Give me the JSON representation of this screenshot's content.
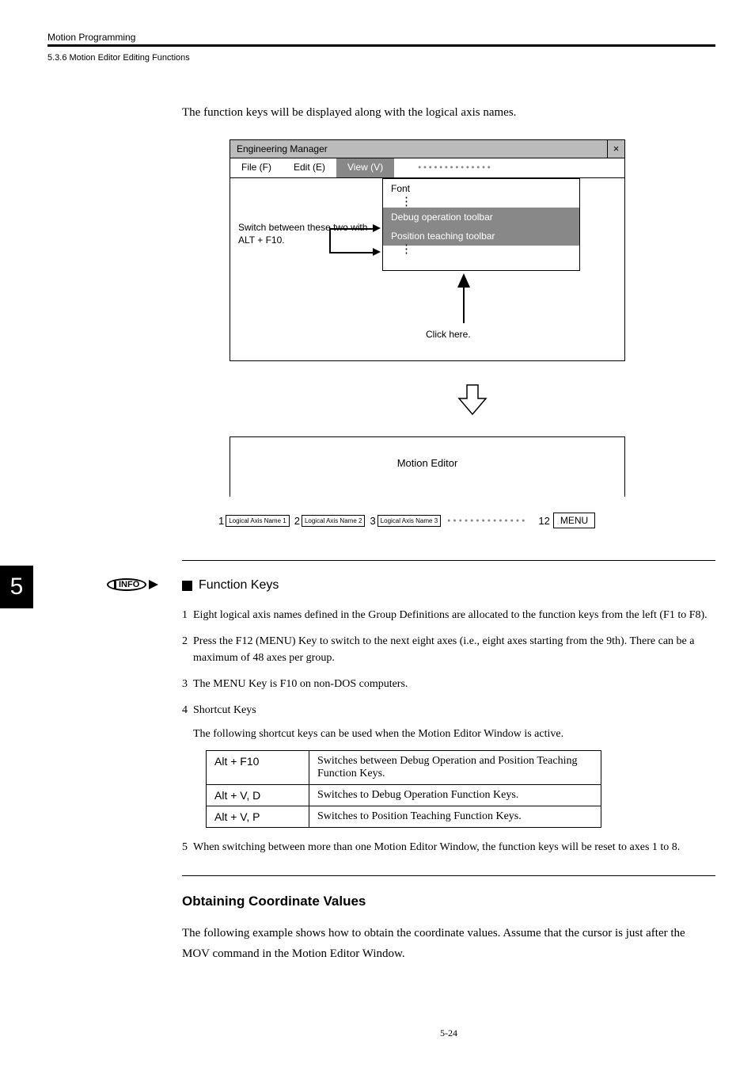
{
  "header": {
    "title": "Motion Programming",
    "subtitle": "5.3.6  Motion Editor Editing Functions"
  },
  "intro": "The function keys will be displayed along with the logical axis names.",
  "figure1": {
    "windowTitle": "Engineering Manager",
    "closeGlyph": "×",
    "menus": {
      "file": "File (F)",
      "edit": "Edit (E)",
      "view": "View (V)"
    },
    "switchText": "Switch between these two with ALT + F10.",
    "dropdown": {
      "font": "Font",
      "debug": "Debug operation toolbar",
      "position": "Position teaching toolbar"
    },
    "clickHere": "Click here."
  },
  "figure2": {
    "title": "Motion Editor",
    "fkeys": {
      "n1": "1",
      "b1": "Logical Axis Name 1",
      "n2": "2",
      "b2": "Logical Axis Name 2",
      "n3": "3",
      "b3": "Logical Axis Name 3",
      "n12": "12",
      "menu": "MENU"
    }
  },
  "pageTab": "5",
  "infoLabel": "INFO",
  "fnKeysTitle": "Function Keys",
  "list": {
    "i1n": "1",
    "i1": "Eight logical axis names defined in the Group Definitions are allocated to the function keys from the left (F1 to F8).",
    "i2n": "2",
    "i2": "Press the F12 (MENU) Key to switch to the next eight axes (i.e., eight axes starting from the 9th). There can be a maximum of 48 axes per group.",
    "i3n": "3",
    "i3": "The MENU Key is F10 on non-DOS computers.",
    "i4n": "4",
    "i4": "Shortcut Keys",
    "i4sub": "The following shortcut keys can be used when the Motion Editor Window is active.",
    "i5n": "5",
    "i5": "When switching between more than one Motion Editor Window, the function keys will be reset to axes 1 to 8."
  },
  "table": {
    "r1k": "Alt + F10",
    "r1v": "Switches between Debug Operation and Position Teaching Function Keys.",
    "r2k": "Alt + V, D",
    "r2v": "Switches to Debug Operation Function Keys.",
    "r3k": "Alt + V, P",
    "r3v": "Switches to Position Teaching Function Keys."
  },
  "section2": {
    "title": "Obtaining Coordinate Values",
    "body": "The following example shows how to obtain the coordinate values. Assume that the cursor is just after the MOV command in the Motion Editor Window."
  },
  "footerPage": "5-24"
}
